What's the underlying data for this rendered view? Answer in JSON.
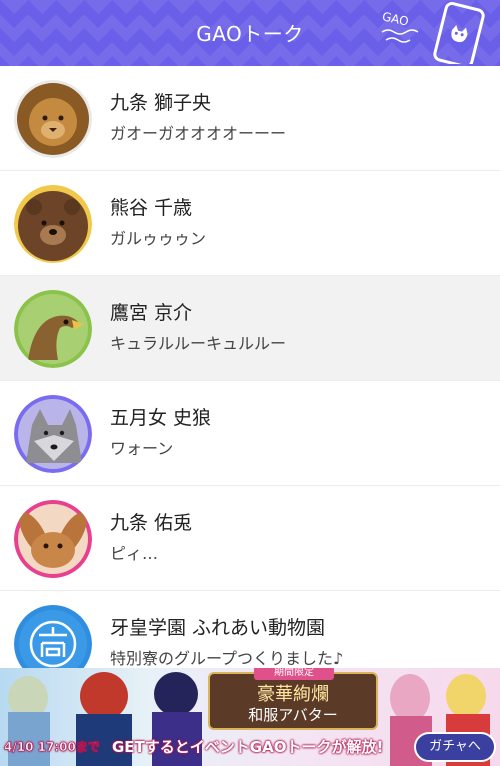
{
  "header": {
    "title": "GAOトーク",
    "mark_text": "GAO",
    "accent_color": "#6a5fe8"
  },
  "chats": [
    {
      "name": "九条 獅子央",
      "message": "ガオーガオオオオーーー",
      "avatar": "lion",
      "ring": "#e9e9e9"
    },
    {
      "name": "熊谷 千歳",
      "message": "ガルゥゥゥン",
      "avatar": "bear",
      "ring": "#f0c94a"
    },
    {
      "name": "鷹宮 京介",
      "message": "キュラルルーキュルルー",
      "avatar": "eagle",
      "ring": "#8bc34a"
    },
    {
      "name": "五月女 史狼",
      "message": "ワォーン",
      "avatar": "wolf",
      "ring": "#7a6cf0"
    },
    {
      "name": "九条 佑兎",
      "message": "ピィ…",
      "avatar": "rabbit",
      "ring": "#e83f8f"
    },
    {
      "name": "牙皇学園 ふれあい動物園",
      "message": "特別寮のグループつくりました♪",
      "avatar": "school-crest",
      "ring": "#2f8ee0"
    }
  ],
  "banner": {
    "tag": "期間限定",
    "title_line1": "豪華絢爛",
    "title_line2": "和服アバター",
    "date": "4/10 17:00まで",
    "caption": "GETするとイベントGAOトークが解放!",
    "button_label": "ガチャへ"
  }
}
